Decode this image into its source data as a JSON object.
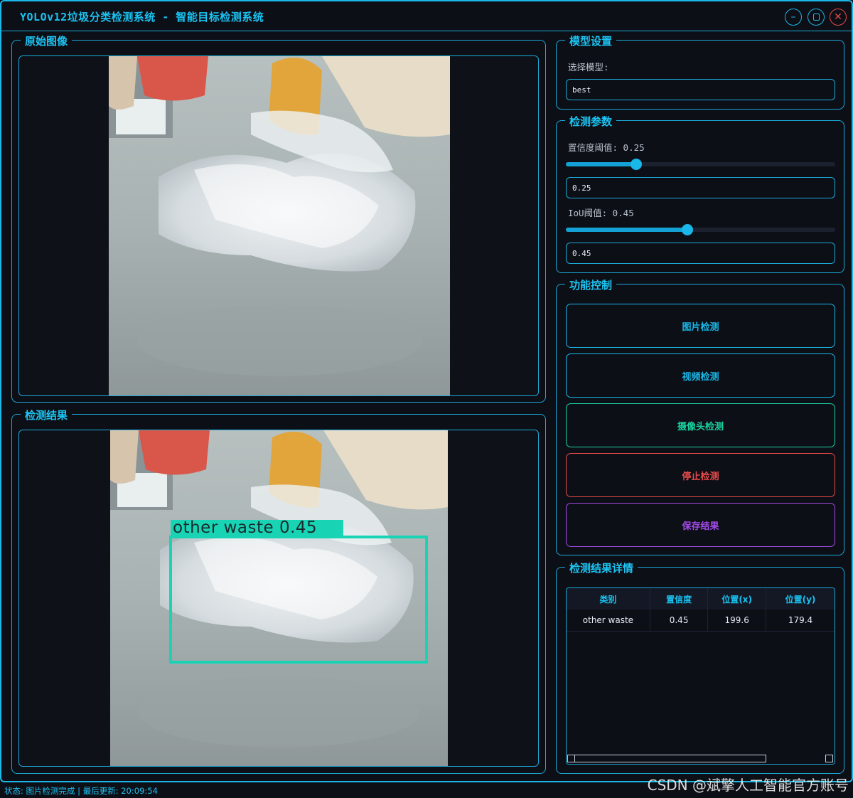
{
  "window": {
    "title": "YOLOv12垃圾分类检测系统 - 智能目标检测系统",
    "minimize_icon": "minimize-icon",
    "maximize_icon": "maximize-icon",
    "close_icon": "close-icon"
  },
  "original_panel": {
    "title": "原始图像"
  },
  "result_panel": {
    "title": "检测结果"
  },
  "detection_box": {
    "label": "other waste 0.45",
    "color": "#19d3b5"
  },
  "model_settings": {
    "title": "模型设置",
    "select_label": "选择模型:",
    "selected_model": "best"
  },
  "detection_params": {
    "title": "检测参数",
    "confidence_label": "置信度阈值: 0.25",
    "confidence_value": "0.25",
    "confidence_level": 0.25,
    "iou_label": "IoU阈值: 0.45",
    "iou_value": "0.45",
    "iou_level": 0.45
  },
  "function_control": {
    "title": "功能控制",
    "buttons": [
      {
        "label": "图片检测",
        "color": "#19b8e8"
      },
      {
        "label": "视频检测",
        "color": "#19b8e8"
      },
      {
        "label": "摄像头检测",
        "color": "#19d3a0"
      },
      {
        "label": "停止检测",
        "color": "#e84b4b"
      },
      {
        "label": "保存结果",
        "color": "#a24be8"
      }
    ]
  },
  "results_detail": {
    "title": "检测结果详情",
    "columns": [
      "类别",
      "置信度",
      "位置(x)",
      "位置(y)"
    ],
    "rows": [
      [
        "other waste",
        "0.45",
        "199.6",
        "179.4"
      ]
    ]
  },
  "status": {
    "text": "状态: 图片检测完成 | 最后更新: 20:09:54"
  },
  "watermark": "CSDN @斌擎人工智能官方账号"
}
